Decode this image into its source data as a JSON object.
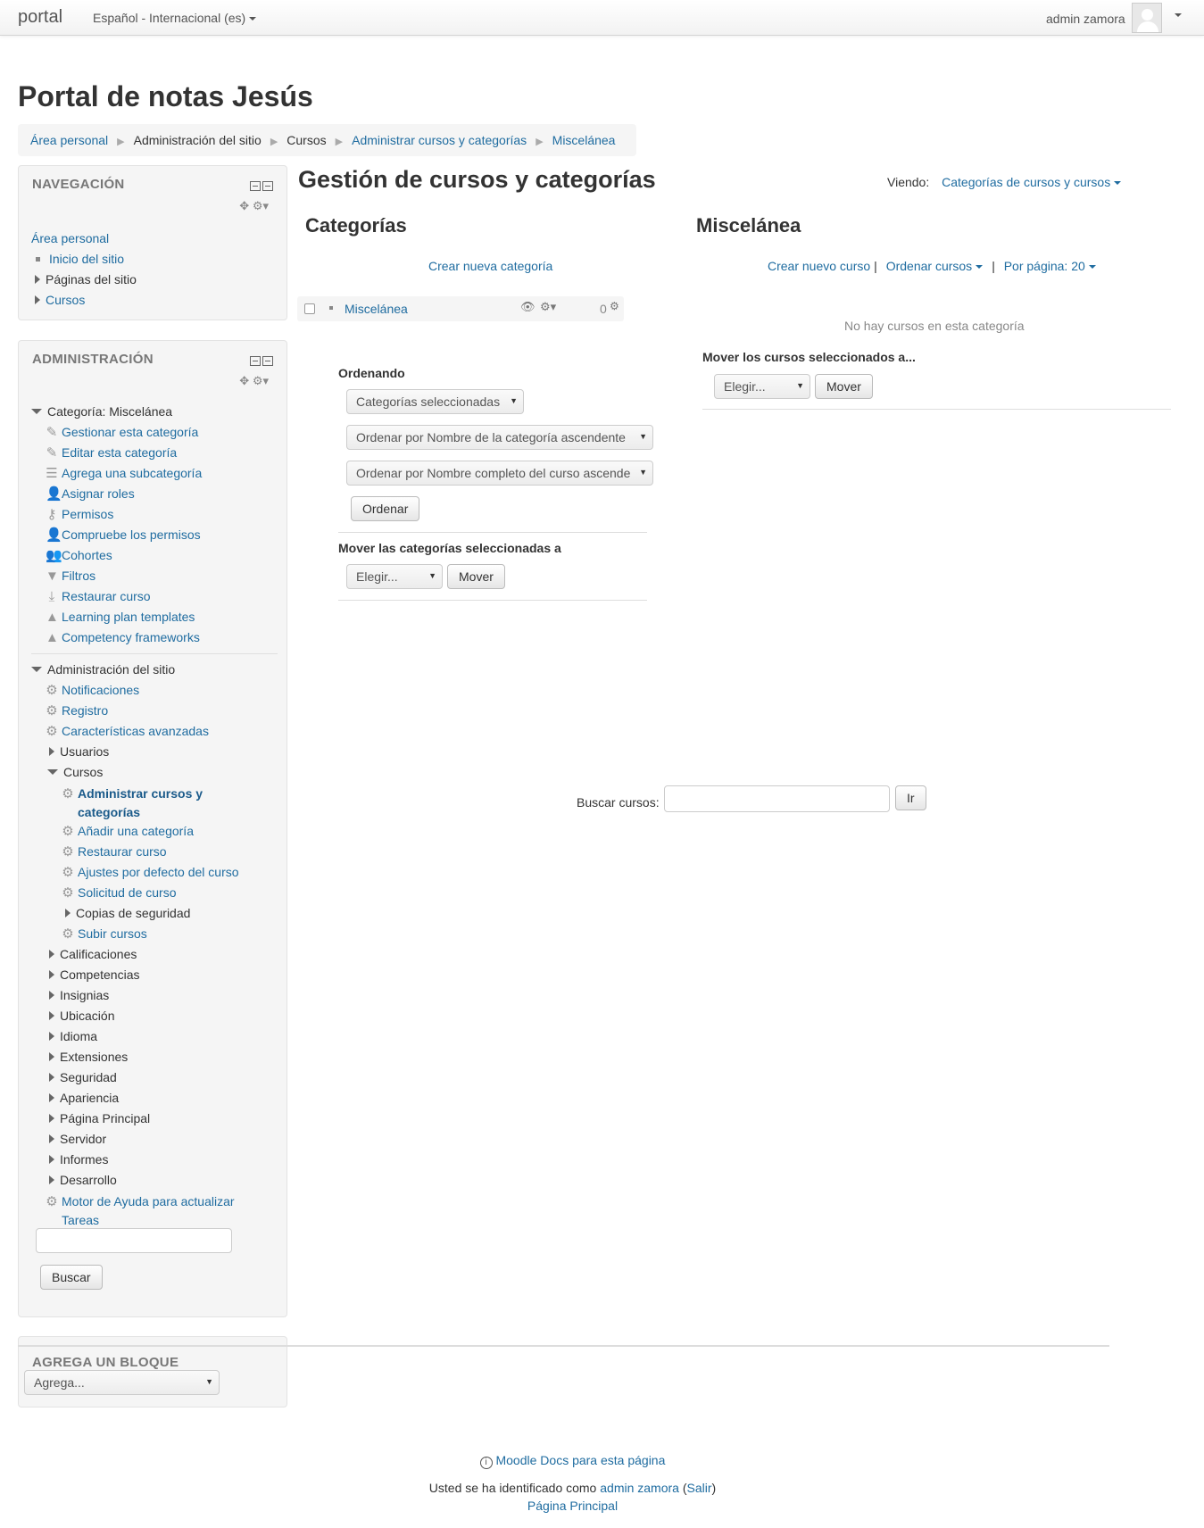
{
  "navbar": {
    "brand": "portal",
    "language": "Español - Internacional (es)",
    "user_name": "admin zamora"
  },
  "header": {
    "site_title": "Portal de notas Jesús",
    "breadcrumb": [
      "Área personal",
      "Administración del sitio",
      "Cursos",
      "Administrar cursos y categorías",
      "Miscelánea"
    ]
  },
  "navigation_block": {
    "title": "NAVEGACIÓN",
    "area_personal": "Área personal",
    "items": [
      "Inicio del sitio",
      "Páginas del sitio",
      "Cursos"
    ]
  },
  "admin_block": {
    "title": "ADMINISTRACIÓN",
    "category_node": "Categoría: Miscelánea",
    "category_items": [
      "Gestionar esta categoría",
      "Editar esta categoría",
      "Agrega una subcategoría",
      "Asignar roles",
      "Permisos",
      "Compruebe los permisos",
      "Cohortes",
      "Filtros",
      "Restaurar curso",
      "Learning plan templates",
      "Competency frameworks"
    ],
    "site_admin_node": "Administración del sitio",
    "site_items_top": [
      "Notificaciones",
      "Registro",
      "Características avanzadas"
    ],
    "usuarios": "Usuarios",
    "cursos": "Cursos",
    "cursos_items": {
      "active_line1": "Administrar cursos y",
      "active_line2": "categorías",
      "items": [
        "Añadir una categoría",
        "Restaurar curso",
        "Ajustes por defecto del curso",
        "Solicitud de curso"
      ],
      "copias": "Copias de seguridad",
      "subir": "Subir cursos"
    },
    "site_items_bottom": [
      "Calificaciones",
      "Competencias",
      "Insignias",
      "Ubicación",
      "Idioma",
      "Extensiones",
      "Seguridad",
      "Apariencia",
      "Página Principal",
      "Servidor",
      "Informes",
      "Desarrollo"
    ],
    "motor_line1": "Motor de Ayuda para actualizar",
    "motor_line2": "Tareas",
    "search_button": "Buscar"
  },
  "add_block": {
    "title": "AGREGA UN BLOQUE",
    "select_value": "Agrega..."
  },
  "main": {
    "heading": "Gestión de cursos y categorías",
    "viewing_label": "Viendo:",
    "viewing_value": "Categorías de cursos y cursos",
    "categories": {
      "heading": "Categorías",
      "create_link": "Crear nueva categoría",
      "row_name": "Miscelánea",
      "row_count": "0",
      "sorting_label": "Ordenando",
      "sort_select_1": "Categorías seleccionadas",
      "sort_select_2": "Ordenar por Nombre de la categoría ascendente",
      "sort_select_3": "Ordenar por Nombre completo del curso ascende",
      "sort_button": "Ordenar",
      "move_label": "Mover las categorías seleccionadas a",
      "move_select": "Elegir...",
      "move_button": "Mover"
    },
    "courses": {
      "heading": "Miscelánea",
      "create_course": "Crear nuevo curso",
      "sort_courses": "Ordenar cursos",
      "per_page": "Por página: 20",
      "empty": "No hay cursos en esta categoría",
      "move_label": "Mover los cursos seleccionados a...",
      "move_select": "Elegir...",
      "move_button": "Mover"
    },
    "search": {
      "label": "Buscar cursos:",
      "button": "Ir"
    }
  },
  "footer": {
    "docs_link": "Moodle Docs para esta página",
    "logged_prefix": "Usted se ha identificado como",
    "logged_user": "admin zamora",
    "logout": "Salir",
    "home": "Página Principal"
  }
}
